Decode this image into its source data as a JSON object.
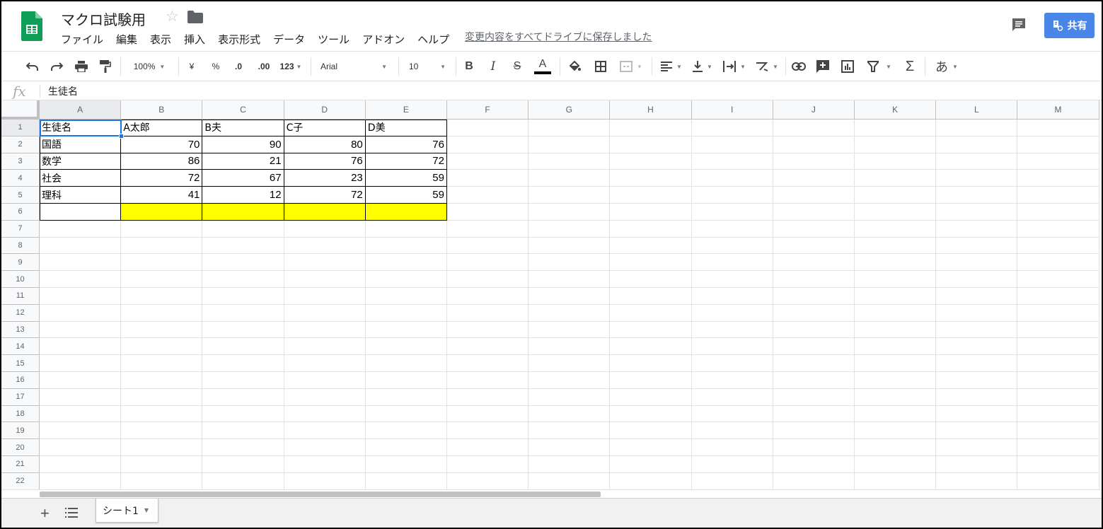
{
  "document": {
    "title": "マクロ試験用",
    "save_status": "変更内容をすべてドライブに保存しました"
  },
  "menu": [
    "ファイル",
    "編集",
    "表示",
    "挿入",
    "表示形式",
    "データ",
    "ツール",
    "アドオン",
    "ヘルプ"
  ],
  "share_button": {
    "label": "共有"
  },
  "toolbar": {
    "zoom": "100%",
    "currency": "¥",
    "percent": "%",
    "decrease_decimal": ".0",
    "increase_decimal": ".00",
    "more_formats": "123",
    "font": "Arial",
    "font_size": "10",
    "bold": "B",
    "italic": "I",
    "strikethrough": "S",
    "text_color": "A",
    "sum": "Σ",
    "input_tools": "あ"
  },
  "formula_bar": {
    "fx": "fx",
    "value": "生徒名"
  },
  "columns": [
    "A",
    "B",
    "C",
    "D",
    "E",
    "F",
    "G",
    "H",
    "I",
    "J",
    "K",
    "L",
    "M"
  ],
  "rows": [
    "1",
    "2",
    "3",
    "4",
    "5",
    "6",
    "7",
    "8",
    "9",
    "10",
    "11",
    "12",
    "13",
    "14",
    "15",
    "16",
    "17",
    "18",
    "19",
    "20",
    "21",
    "22"
  ],
  "selected_cell": "A1",
  "sheet": {
    "cells": [
      [
        "生徒名",
        "A太郎",
        "B夫",
        "C子",
        "D美"
      ],
      [
        "国語",
        "70",
        "90",
        "80",
        "76"
      ],
      [
        "数学",
        "86",
        "21",
        "76",
        "72"
      ],
      [
        "社会",
        "72",
        "67",
        "23",
        "59"
      ],
      [
        "理科",
        "41",
        "12",
        "72",
        "59"
      ],
      [
        "",
        "",
        "",
        "",
        ""
      ]
    ]
  },
  "highlight_color": "#ffff00",
  "accent_color": "#4a86e8",
  "sheet_tabs": [
    {
      "label": "シート1"
    }
  ]
}
